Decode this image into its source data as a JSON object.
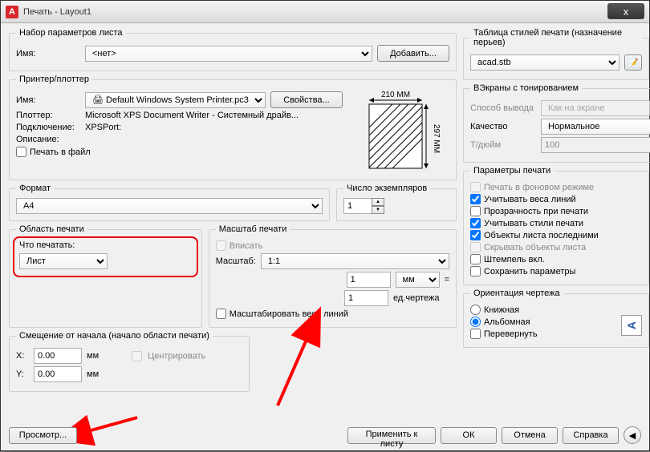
{
  "window": {
    "title": "Печать - Layout1",
    "close": "x"
  },
  "pageset": {
    "legend": "Набор параметров листа",
    "name_label": "Имя:",
    "name_value": "<нет>",
    "add_btn": "Добавить..."
  },
  "printer": {
    "legend": "Принтер/плоттер",
    "name_label": "Имя:",
    "name_value": "Default Windows System Printer.pc3",
    "props_btn": "Свойства...",
    "plotter_label": "Плоттер:",
    "plotter_value": "Microsoft XPS Document Writer - Системный драйв...",
    "port_label": "Подключение:",
    "port_value": "XPSPort:",
    "desc_label": "Описание:",
    "to_file": "Печать в файл",
    "width_mm": "210 MM",
    "height_mm": "297 MM"
  },
  "format": {
    "legend": "Формат",
    "value": "A4"
  },
  "copies": {
    "legend": "Число экземпляров",
    "value": "1"
  },
  "area": {
    "legend": "Область печати",
    "what_label": "Что печатать:",
    "what_value": "Лист"
  },
  "scale": {
    "legend": "Масштаб печати",
    "fit": "Вписать",
    "scale_label": "Масштаб:",
    "scale_value": "1:1",
    "mm": "мм",
    "count": "1",
    "units": "ед.чертежа",
    "scale_lw": "Масштабировать веса линий",
    "unit_num": "1",
    "eq": "="
  },
  "offset": {
    "legend": "Смещение от начала (начало области печати)",
    "x": "X:",
    "y": "Y:",
    "xv": "0.00",
    "yv": "0.00",
    "mm": "мм",
    "center": "Центрировать"
  },
  "styles": {
    "legend": "Таблица стилей печати (назначение перьев)",
    "value": "acad.stb"
  },
  "viewport": {
    "legend": "ВЭкраны с тонированием",
    "mode_label": "Способ вывода",
    "mode_value": "Как на экране",
    "quality_label": "Качество",
    "quality_value": "Нормальное",
    "dpi_label": "Т/дюйм",
    "dpi_value": "100"
  },
  "options": {
    "legend": "Параметры печати",
    "bg": "Печать в фоновом режиме",
    "lw": "Учитывать веса линий",
    "transparency": "Прозрачность при печати",
    "plotstyles": "Учитывать стили печати",
    "paperspace": "Объекты листа последними",
    "hide": "Скрывать объекты листа",
    "stamp": "Штемпель вкл.",
    "save": "Сохранить параметры"
  },
  "orient": {
    "legend": "Ориентация чертежа",
    "portrait": "Книжная",
    "landscape": "Альбомная",
    "upside": "Перевернуть",
    "icon": "A"
  },
  "footer": {
    "preview": "Просмотр...",
    "apply": "Применить к листу",
    "ok": "ОК",
    "cancel": "Отмена",
    "help": "Справка"
  }
}
